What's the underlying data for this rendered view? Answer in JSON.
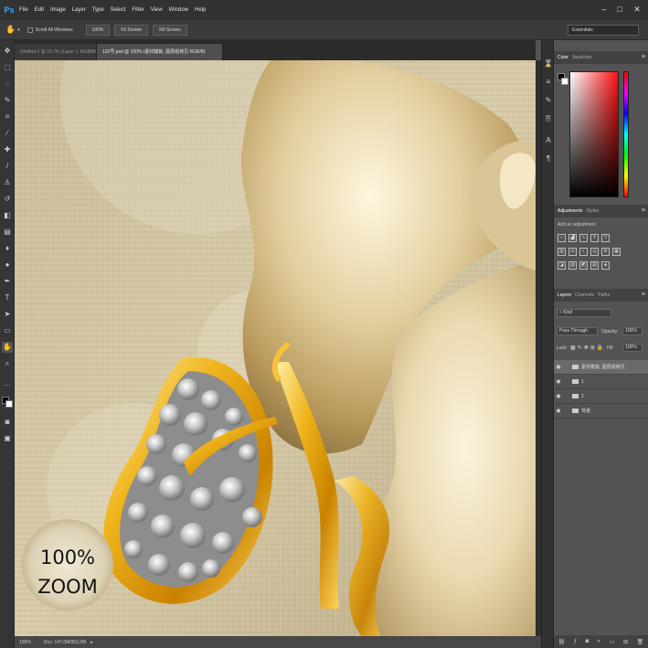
{
  "app": {
    "logo": "Ps"
  },
  "menu": [
    "File",
    "Edit",
    "Image",
    "Layer",
    "Type",
    "Select",
    "Filter",
    "View",
    "Window",
    "Help"
  ],
  "window_controls": {
    "minimize": "–",
    "restore": "□",
    "close": "✕"
  },
  "options": {
    "tool_glyph": "✋",
    "scroll_all": "Scroll All Windows",
    "btn_100": "100%",
    "fit_screen": "Fit Screen",
    "fill_screen": "Fill Screen"
  },
  "workspace": "Essentials",
  "tabs": [
    {
      "label": "Untitled-1 @ 16.7% (Layer 1, RGB/8#) *",
      "active": false
    },
    {
      "label": "132号.psd @ 100% (素材模板, 图层组拷贝 RGB/8)",
      "active": true
    }
  ],
  "canvas_overlay": {
    "line1": "100%",
    "line2": "ZOOM"
  },
  "status": {
    "zoom": "100%",
    "doc": "Doc: 147.0M/953.2M"
  },
  "color_panel": {
    "tabs": [
      "Color",
      "Swatches"
    ]
  },
  "adjustments_panel": {
    "tabs": [
      "Adjustments",
      "Styles"
    ],
    "hint": "Add an adjustment"
  },
  "layers_panel": {
    "tabs": [
      "Layers",
      "Channels",
      "Paths"
    ],
    "filter": "Kind",
    "blend": "Pass Through",
    "opacity_label": "Opacity:",
    "opacity": "100%",
    "lock_label": "Lock:",
    "fill_label": "Fill:",
    "fill": "100%",
    "layers": [
      {
        "name": "素材模板, 图层组拷贝",
        "selected": true
      },
      {
        "name": "1",
        "selected": false
      },
      {
        "name": "2",
        "selected": false
      },
      {
        "name": "背景",
        "selected": false
      }
    ],
    "footer_icons": [
      "link-icon",
      "fx-icon",
      "mask-icon",
      "adjust-icon",
      "folder-icon",
      "new-layer-icon",
      "trash-icon"
    ]
  },
  "colors": {
    "accent": "#31a8ff",
    "selected_layer": "#6a6a6a"
  }
}
